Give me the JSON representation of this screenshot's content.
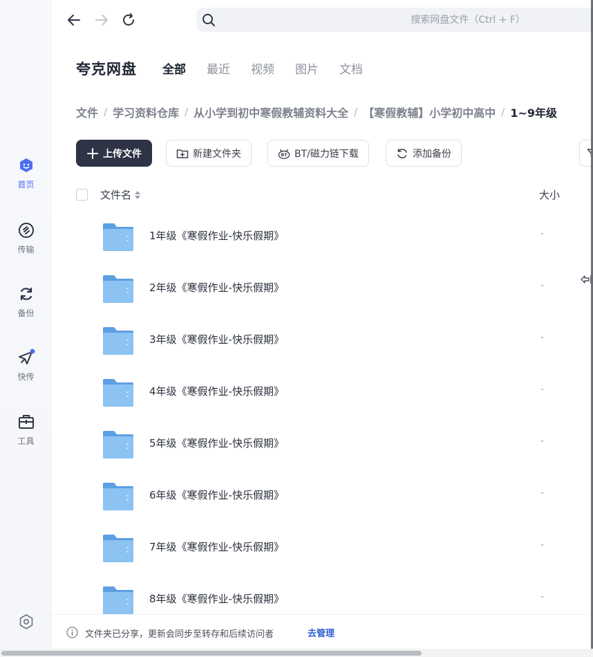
{
  "sidebar": {
    "items": [
      {
        "label": "首页",
        "icon": "home-face-icon"
      },
      {
        "label": "传输",
        "icon": "transfer-icon"
      },
      {
        "label": "备份",
        "icon": "backup-icon"
      },
      {
        "label": "快传",
        "icon": "quick-send-icon"
      },
      {
        "label": "工具",
        "icon": "toolbox-icon"
      }
    ],
    "settings_icon": "settings-hexagon-icon"
  },
  "topbar": {
    "search_placeholder": "搜索网盘文件（Ctrl + F）"
  },
  "header": {
    "brand": "夸克网盘",
    "tabs": [
      "全部",
      "最近",
      "视频",
      "图片",
      "文档"
    ],
    "active_tab": "全部"
  },
  "breadcrumb": [
    "文件",
    "学习资料仓库",
    "从小学到初中寒假教辅资料大全",
    "【寒假教辅】小学初中高中",
    "1~9年级"
  ],
  "toolbar": {
    "upload": "上传文件",
    "new_folder": "新建文件夹",
    "bt_download": "BT/磁力链下载",
    "add_backup": "添加备份"
  },
  "table": {
    "col_name": "文件名",
    "col_size": "大小",
    "rows": [
      {
        "name": "1年级《寒假作业-快乐假期》",
        "size": "-"
      },
      {
        "name": "2年级《寒假作业-快乐假期》",
        "size": "-"
      },
      {
        "name": "3年级《寒假作业-快乐假期》",
        "size": "-"
      },
      {
        "name": "4年级《寒假作业-快乐假期》",
        "size": "-"
      },
      {
        "name": "5年级《寒假作业-快乐假期》",
        "size": "-"
      },
      {
        "name": "6年级《寒假作业-快乐假期》",
        "size": "-"
      },
      {
        "name": "7年级《寒假作业-快乐假期》",
        "size": "-"
      },
      {
        "name": "8年级《寒假作业-快乐假期》",
        "size": "-"
      }
    ]
  },
  "notice": {
    "text": "文件夹已分享，更新会同步至转存和后续访问者",
    "link": "去管理"
  },
  "colors": {
    "accent": "#4e6ef2",
    "primary_button": "#2e3345",
    "folder": "#7fb8ef",
    "link": "#2f5fd6"
  }
}
